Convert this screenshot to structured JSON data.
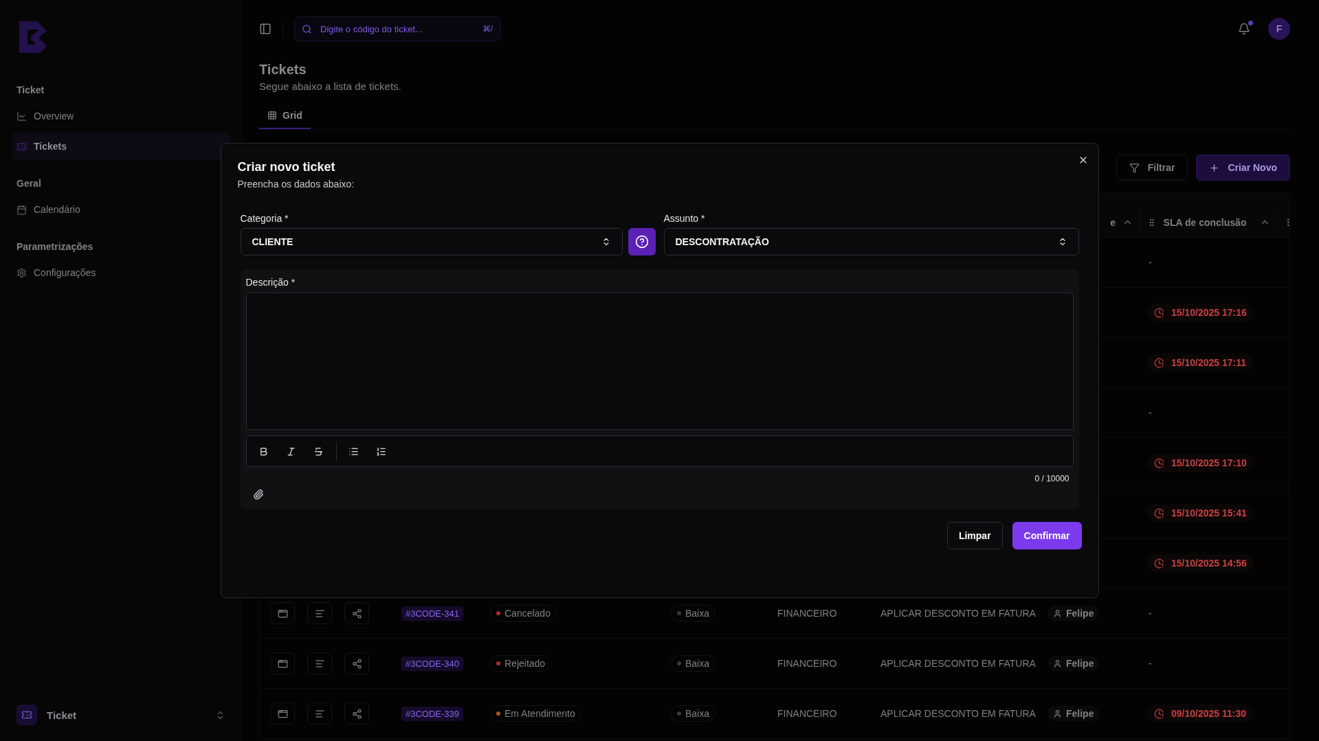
{
  "sidebar": {
    "sections": [
      {
        "title": "Ticket",
        "items": [
          {
            "label": "Overview",
            "selected": false
          },
          {
            "label": "Tickets",
            "selected": true
          }
        ]
      },
      {
        "title": "Geral",
        "items": [
          {
            "label": "Calendário",
            "selected": false
          }
        ]
      },
      {
        "title": "Parametrizações",
        "items": [
          {
            "label": "Configurações",
            "selected": false
          }
        ]
      }
    ],
    "workspace": {
      "name": "Ticket"
    }
  },
  "topbar": {
    "search": {
      "placeholder": "Digite o código do ticket...",
      "shortcut": "⌘/"
    },
    "notifications": {
      "unread": true
    },
    "avatar": {
      "initial": "F"
    }
  },
  "page": {
    "title": "Tickets",
    "subtitle": "Segue abaixo a lista de tickets.",
    "tabs": [
      {
        "label": "Grid",
        "selected": true
      }
    ]
  },
  "toolbar": {
    "buttons": [
      {
        "label": "Filtrar",
        "kind": "outline"
      },
      {
        "label": "Criar Novo",
        "kind": "primary"
      }
    ]
  },
  "table": {
    "header": {
      "column_8": "e",
      "column_9": "SLA de conclusão"
    },
    "rows": [
      {
        "sla": "-"
      },
      {
        "sla": "15/10/2025 17:16"
      },
      {
        "sla": "15/10/2025 17:11"
      },
      {
        "sla": "-"
      },
      {
        "sla": "15/10/2025 17:10"
      },
      {
        "sla": "15/10/2025 15:41"
      },
      {
        "sla": "15/10/2025 14:56"
      },
      {
        "code": "#3CODE-341",
        "status": "Cancelado",
        "color": "#b02a2a",
        "priority": "Baixa",
        "category": "FINANCEIRO",
        "subject": "APLICAR DESCONTO EM FATURA",
        "assignee": "Felipe",
        "sla": "-"
      },
      {
        "code": "#3CODE-340",
        "status": "Rejeitado",
        "color": "#b02a2a",
        "priority": "Baixa",
        "category": "FINANCEIRO",
        "subject": "APLICAR DESCONTO EM FATURA",
        "assignee": "Felipe",
        "sla": "-"
      },
      {
        "code": "#3CODE-339",
        "status": "Em Atendimento",
        "color": "#b0541a",
        "priority": "Baixa",
        "category": "FINANCEIRO",
        "subject": "APLICAR DESCONTO EM FATURA",
        "assignee": "Felipe",
        "sla": "09/10/2025 11:30"
      }
    ]
  },
  "modal": {
    "title": "Criar novo ticket",
    "subtitle": "Preencha os dados abaixo:",
    "fields": [
      {
        "label": "Categoria *",
        "value": "CLIENTE"
      },
      {
        "label": "Assunto *",
        "value": "DESCONTRATAÇÃO"
      }
    ],
    "description": {
      "label": "Descrição *",
      "counter": "0 / 10000"
    },
    "buttons": [
      {
        "label": "Limpar",
        "kind": "outline"
      },
      {
        "label": "Confirmar",
        "kind": "primary"
      }
    ]
  }
}
